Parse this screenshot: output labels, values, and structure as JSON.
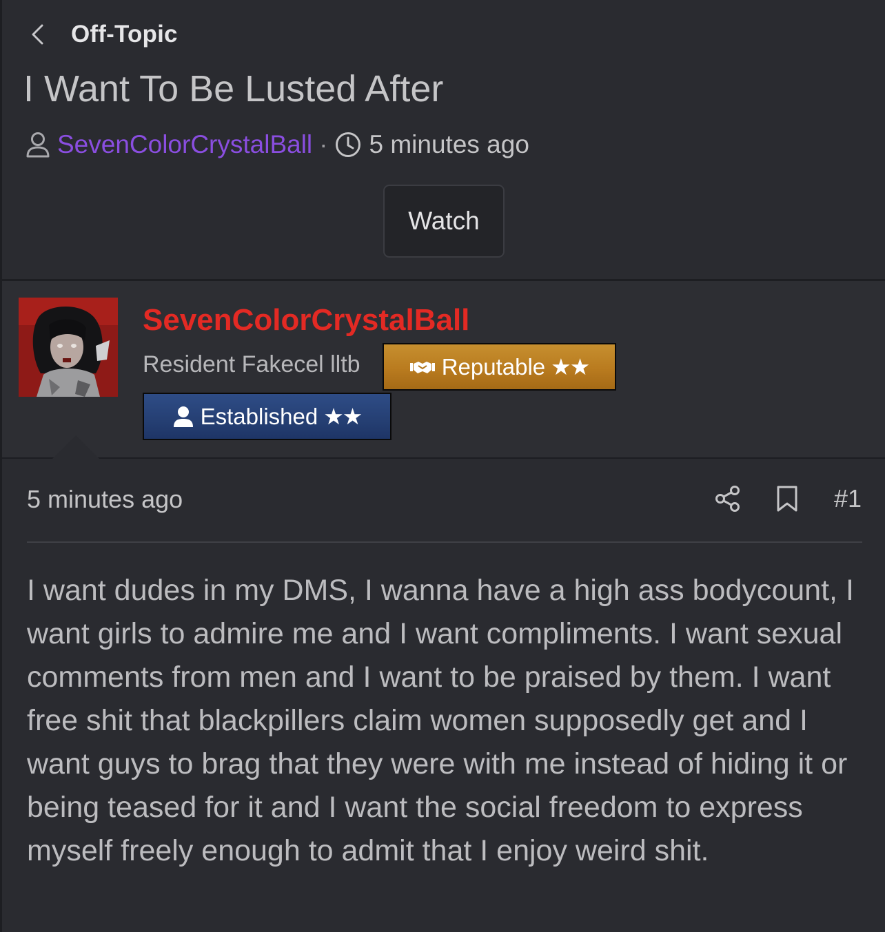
{
  "header": {
    "breadcrumb": "Off-Topic",
    "title": "I Want To Be Lusted After",
    "author": "SevenColorCrystalBall",
    "separator": "·",
    "time": "5 minutes ago",
    "watch_label": "Watch"
  },
  "user_card": {
    "username": "SevenColorCrystalBall",
    "user_title": "Resident Fakecel lltb",
    "badges": [
      {
        "label": "Reputable",
        "stars": "★★",
        "icon": "handshake-icon",
        "color": "#c08527"
      },
      {
        "label": "Established",
        "stars": "★★",
        "icon": "user-icon",
        "color": "#274377"
      }
    ],
    "username_color": "#e32a24"
  },
  "post": {
    "time": "5 minutes ago",
    "number": "#1",
    "body": "I want dudes in my DMS, I wanna have a high ass bodycount, I want girls to admire me and I want compliments. I want sexual comments from men and I want to be praised by them. I want free shit that blackpillers claim women supposedly get and I want guys to brag that they were with me instead of hiding it or being teased for it and I want the social freedom to express myself freely enough to admit that I enjoy weird shit."
  },
  "colors": {
    "background": "#2a2b30",
    "card": "#2d2e33",
    "author_link": "#8a4ee0"
  }
}
